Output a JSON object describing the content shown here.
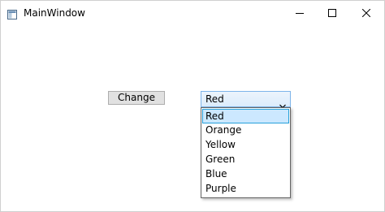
{
  "window": {
    "title": "MainWindow"
  },
  "controls": {
    "change_button_label": "Change",
    "combo": {
      "selected": "Red",
      "options": [
        "Red",
        "Orange",
        "Yellow",
        "Green",
        "Blue",
        "Purple"
      ],
      "highlighted_index": 0
    }
  },
  "colors": {
    "selection_fill": "#cce8ff",
    "selection_border": "#26a0da",
    "combo_border": "#7eb4ea"
  }
}
